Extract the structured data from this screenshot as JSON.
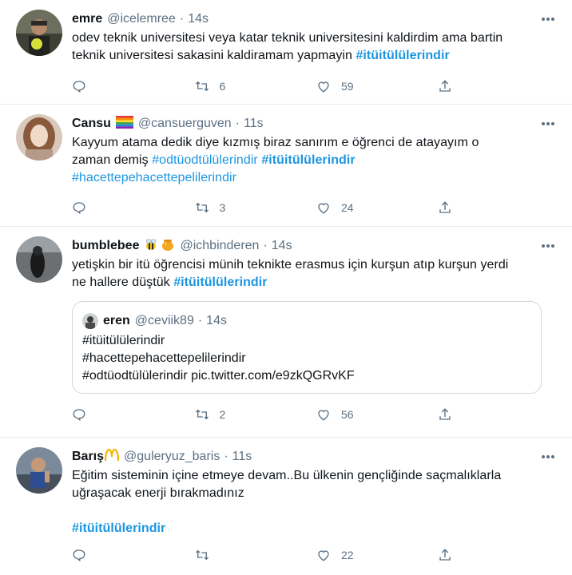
{
  "tweets": [
    {
      "name": "emre",
      "handle": "@icelemree",
      "time": "14s",
      "text_lines": [
        "odev teknik universitesi veya katar teknik universitesini kaldirdim ama bartin",
        "teknik universitesi sakasini kaldiramam yapmayin"
      ],
      "hashtag": "#itüitülülerindir",
      "retweets": "6",
      "likes": "59"
    },
    {
      "name": "Cansu",
      "emoji": "rainbow-flag",
      "handle": "@cansuerguven",
      "time": "11s",
      "text_line1": "Kayyum atama dedik diye kızmış biraz sanırım e öğrenci de atayayım o",
      "text_line2_prefix": "zaman demiş",
      "tag_a": "#odtüodtülülerindir",
      "tag_b": "#itüitülülerindir",
      "tag_c": "#hacettepehacettepelilerindir",
      "retweets": "3",
      "likes": "24"
    },
    {
      "name": "bumblebee",
      "emoji": "bee-honey",
      "handle": "@ichbinderen",
      "time": "14s",
      "text_line1": "yetişkin bir itü öğrencisi münih teknikte erasmus için kurşun atıp kurşun yerdi",
      "text_line2_prefix": "ne hallere düştük",
      "hashtag": "#itüitülülerindir",
      "quote": {
        "name": "eren",
        "handle": "@ceviik89",
        "time": "14s",
        "lines": [
          "#itüitülülerindir",
          "#hacettepehacettepelilerindir",
          "#odtüodtülülerindir pic.twitter.com/e9zkQGRvKF"
        ]
      },
      "retweets": "2",
      "likes": "56"
    },
    {
      "name": "Barış",
      "emoji": "mcdonalds-arches",
      "handle": "@guleryuz_baris",
      "time": "11s",
      "text_lines": [
        "Eğitim sisteminin içine etmeye devam..Bu ülkenin gençliğinde saçmalıklarla",
        "uğraşacak enerji bırakmadınız"
      ],
      "hashtag": "#itüitülülerindir",
      "retweets": "",
      "likes": "22"
    }
  ],
  "colors": {
    "accent": "#1b95e0",
    "muted": "#5b7083",
    "border": "#e6ecf0"
  },
  "dot": "·"
}
